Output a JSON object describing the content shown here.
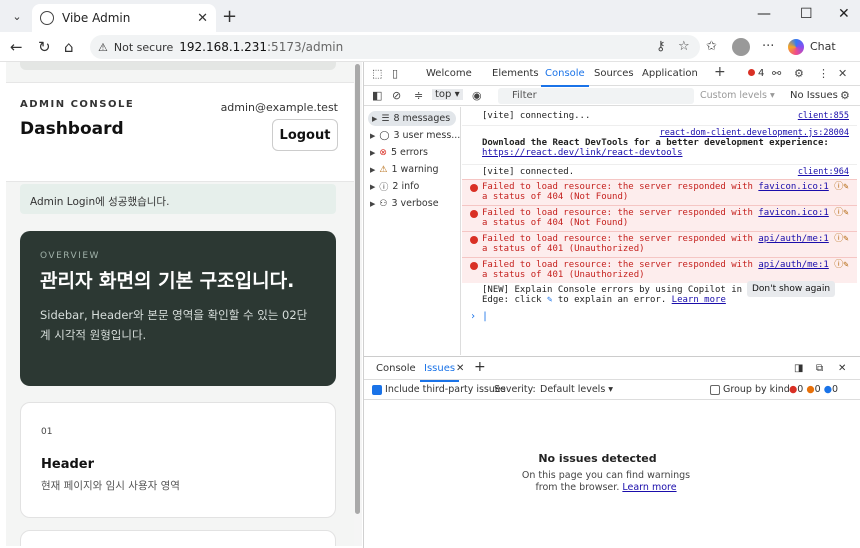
{
  "browser": {
    "tab_title": "Vibe Admin",
    "security_label": "Not secure",
    "url_host": "192.168.1.231",
    "url_path": ":5173/admin",
    "chat_label": "Chat"
  },
  "page": {
    "admin_console": "ADMIN CONSOLE",
    "admin_email": "admin@example.test",
    "dashboard_title": "Dashboard",
    "logout_label": "Logout",
    "success_message": "Admin Login에 성공했습니다.",
    "overview_label": "OVERVIEW",
    "overview_headline": "관리자 화면의 기본 구조입니다.",
    "overview_desc": "Sidebar, Header와 본문 영역을 확인할 수 있는 02단계 시각적 원형입니다.",
    "card_num": "01",
    "card_title": "Header",
    "card_sub": "현재 페이지와 임시 사용자 영역"
  },
  "devtools": {
    "tabs": [
      "Welcome",
      "Elements",
      "Console",
      "Sources",
      "Application"
    ],
    "active_tab": "Console",
    "error_count": "4",
    "context": "top",
    "filter_placeholder": "Filter",
    "custom_levels": "Custom levels",
    "no_issues": "No Issues",
    "sidebar": [
      {
        "label": "8 messages"
      },
      {
        "label": "3 user mess..."
      },
      {
        "label": "5 errors"
      },
      {
        "label": "1 warning"
      },
      {
        "label": "2 info"
      },
      {
        "label": "3 verbose"
      }
    ],
    "console": {
      "l1": "[vite] connecting...",
      "l1_src": "client:855",
      "l2_src": "react-dom-client.development.js:28004",
      "l2a": "Download the React DevTools for a better development experience:",
      "l2b": "https://react.dev/link/react-devtools",
      "l3": "[vite] connected.",
      "l3_src": "client:964",
      "e1a": "Failed to load resource: the server responded with",
      "e1b": "a status of 404 (Not Found)",
      "e1_src": "favicon.ico:1",
      "e2a": "Failed to load resource: the server responded with",
      "e2b": "a status of 404 (Not Found)",
      "e2_src": "favicon.ico:1",
      "e3a": "Failed to load resource: the server responded with",
      "e3b": "a status of 401 (Unauthorized)",
      "e3_src": "api/auth/me:1",
      "e4a": "Failed to load resource: the server responded with",
      "e4b": "a status of 401 (Unauthorized)",
      "e4_src": "api/auth/me:1",
      "n1": "[NEW] Explain Console errors by using Copilot in",
      "n2a": "Edge: click",
      "n2b": "to explain an error.",
      "n2_link": "Learn more",
      "dont_show": "Don't show again"
    },
    "drawer": {
      "tabs": [
        "Console",
        "Issues"
      ],
      "active_tab": "Issues",
      "include_third_party": "Include third-party issues",
      "severity_label": "Severity:",
      "severity_value": "Default levels",
      "group_by_kind": "Group by kind",
      "counts": [
        "0",
        "0",
        "0"
      ],
      "no_issues_title": "No issues detected",
      "no_issues_desc": "On this page you can find warnings from the browser.",
      "learn_more": "Learn more"
    }
  },
  "colors": {
    "accent": "#1a73e8",
    "error": "#d93025",
    "overview_bg": "#2c3833"
  }
}
